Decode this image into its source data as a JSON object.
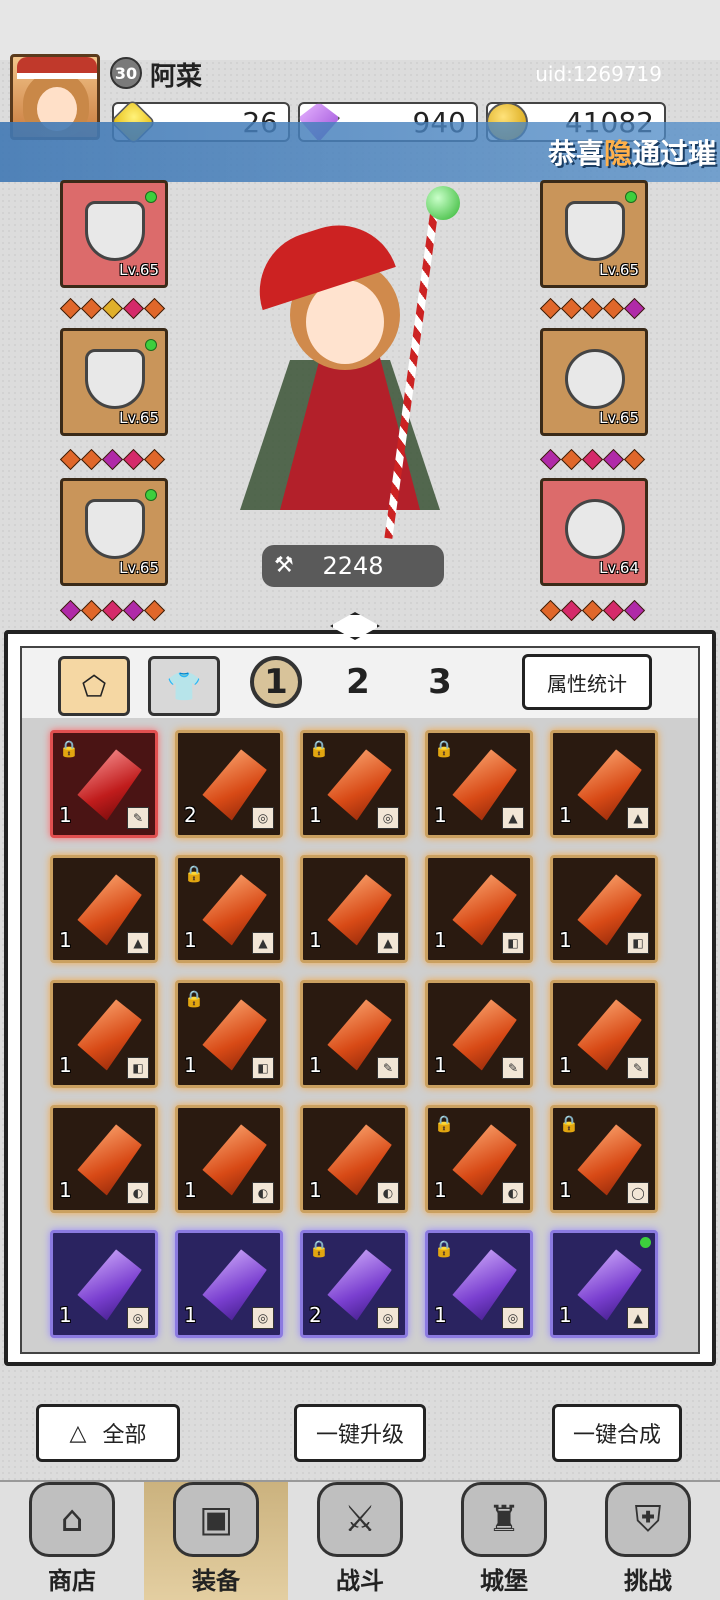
{
  "player": {
    "level": "30",
    "name": "阿菜",
    "uid": "uid:1269719"
  },
  "currencies": {
    "energy": "26",
    "gems": "940",
    "gold": "41082"
  },
  "marquee": {
    "prefix": "恭喜",
    "highlight": "隐",
    "suffix": "通过璀"
  },
  "equipment": {
    "left": [
      {
        "level": "Lv.65",
        "color": "red"
      },
      {
        "level": "Lv.65",
        "color": "tan"
      },
      {
        "level": "Lv.65",
        "color": "tan"
      }
    ],
    "right": [
      {
        "level": "Lv.65",
        "color": "tan"
      },
      {
        "level": "Lv.65",
        "color": "tan"
      },
      {
        "level": "Lv.64",
        "color": "red"
      }
    ]
  },
  "hero": {
    "power": "2248"
  },
  "panel": {
    "pages": [
      "1",
      "2",
      "3"
    ],
    "stats_button": "属性统计"
  },
  "grid": [
    {
      "qty": "1",
      "kind": "red",
      "lock": true
    },
    {
      "qty": "2",
      "kind": "orange",
      "lock": false
    },
    {
      "qty": "1",
      "kind": "orange",
      "lock": true
    },
    {
      "qty": "1",
      "kind": "orange",
      "lock": true
    },
    {
      "qty": "1",
      "kind": "orange",
      "lock": false
    },
    {
      "qty": "1",
      "kind": "orange",
      "lock": false
    },
    {
      "qty": "1",
      "kind": "orange",
      "lock": true
    },
    {
      "qty": "1",
      "kind": "orange",
      "lock": false
    },
    {
      "qty": "1",
      "kind": "orange",
      "lock": false
    },
    {
      "qty": "1",
      "kind": "orange",
      "lock": false
    },
    {
      "qty": "1",
      "kind": "orange",
      "lock": false
    },
    {
      "qty": "1",
      "kind": "orange",
      "lock": true
    },
    {
      "qty": "1",
      "kind": "orange",
      "lock": false
    },
    {
      "qty": "1",
      "kind": "orange",
      "lock": false
    },
    {
      "qty": "1",
      "kind": "orange",
      "lock": false
    },
    {
      "qty": "1",
      "kind": "orange",
      "lock": false
    },
    {
      "qty": "1",
      "kind": "orange",
      "lock": false
    },
    {
      "qty": "1",
      "kind": "orange",
      "lock": false
    },
    {
      "qty": "1",
      "kind": "orange",
      "lock": true
    },
    {
      "qty": "1",
      "kind": "orange",
      "lock": true
    },
    {
      "qty": "1",
      "kind": "purple",
      "lock": false
    },
    {
      "qty": "1",
      "kind": "purple",
      "lock": false
    },
    {
      "qty": "2",
      "kind": "purple",
      "lock": true
    },
    {
      "qty": "1",
      "kind": "purple",
      "lock": true
    },
    {
      "qty": "1",
      "kind": "purple",
      "lock": false
    }
  ],
  "actions": {
    "all": "全部",
    "upgrade": "一键升级",
    "merge": "一键合成"
  },
  "nav": {
    "shop": "商店",
    "equip": "装备",
    "battle": "战斗",
    "castle": "城堡",
    "challenge": "挑战"
  }
}
